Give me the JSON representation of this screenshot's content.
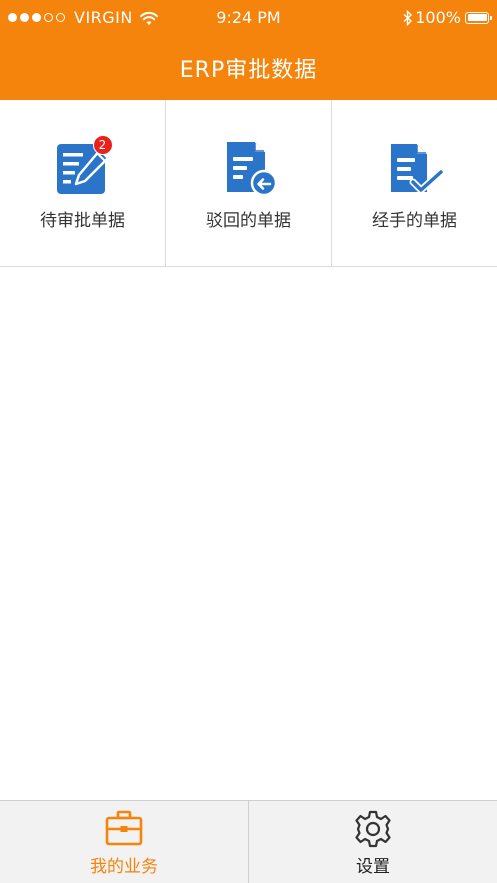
{
  "status_bar": {
    "carrier": "VIRGIN",
    "time": "9:24 PM",
    "battery": "100%"
  },
  "header": {
    "title": "ERP审批数据"
  },
  "grid": {
    "items": [
      {
        "label": "待审批单据",
        "badge": "2",
        "icon": "edit-document-icon"
      },
      {
        "label": "驳回的单据",
        "icon": "rejected-document-icon"
      },
      {
        "label": "经手的单据",
        "icon": "checked-document-icon"
      }
    ]
  },
  "tabbar": {
    "tabs": [
      {
        "label": "我的业务",
        "icon": "briefcase-icon",
        "active": true
      },
      {
        "label": "设置",
        "icon": "gear-icon",
        "active": false
      }
    ]
  },
  "colors": {
    "accent": "#f5840c",
    "icon_blue": "#2a75c9",
    "badge_red": "#e8231b"
  }
}
